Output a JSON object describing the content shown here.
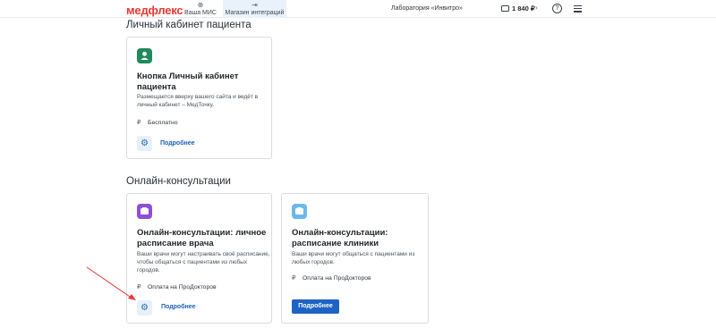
{
  "header": {
    "logo": "медфлекс",
    "tabs": [
      {
        "label": "Ваша МИС",
        "icon": "plus-circle-icon"
      },
      {
        "label": "Магазин интеграций",
        "icon": "export-icon"
      }
    ],
    "lab": "Лаборатория «Инвитро»",
    "balance": "1 840 ₽",
    "help_glyph": "?"
  },
  "sections": [
    {
      "title": "Личный кабинет пациента",
      "cards": [
        {
          "title": "Кнопка Личный кабинет пациента",
          "desc": "Размещается вверху вашего сайта и ведёт в личный кабинет – МедТочку.",
          "price": "Бесплатно",
          "action": "Подробнее",
          "badge_color": "#1f8a5b"
        }
      ]
    },
    {
      "title": "Онлайн-консультации",
      "cards": [
        {
          "title": "Онлайн-консультации: личное расписание врача",
          "desc": "Ваши врачи могут настраивать своё расписание, чтобы общаться с пациентами из любых городов.",
          "price": "Оплата на ПроДокторов",
          "action": "Подробнее",
          "badge_color": "#8e4fd6"
        },
        {
          "title": "Онлайн-консультации: расписание клиники",
          "desc": "Ваши врачи могут общаться с пациентами из любых городов.",
          "price": "Оплата на ПроДокторов",
          "action": "Подробнее",
          "badge_color": "#6cb8ee"
        }
      ]
    }
  ],
  "currency_symbol": "₽",
  "colors": {
    "accent": "#1e63c3",
    "brand": "#e53935",
    "annotation_arrow": "#e53935"
  }
}
